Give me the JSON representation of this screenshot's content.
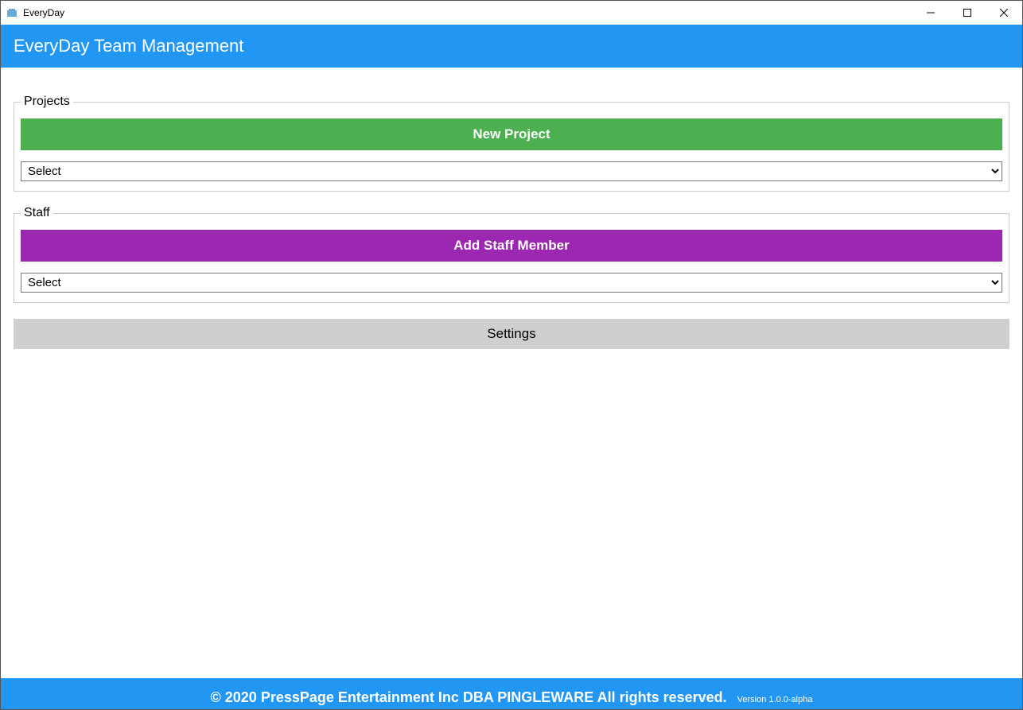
{
  "window": {
    "title": "EveryDay"
  },
  "header": {
    "title": "EveryDay Team Management"
  },
  "projects": {
    "legend": "Projects",
    "new_button": "New Project",
    "select_placeholder": "Select"
  },
  "staff": {
    "legend": "Staff",
    "add_button": "Add Staff Member",
    "select_placeholder": "Select"
  },
  "settings": {
    "button": "Settings"
  },
  "footer": {
    "copyright": "© 2020 PressPage Entertainment Inc DBA PINGLEWARE  All rights reserved.",
    "version": "Version 1.0.0-alpha"
  },
  "colors": {
    "accent_blue": "#2196f3",
    "green": "#4caf50",
    "purple": "#9c27b0",
    "gray": "#cfcfcf"
  }
}
